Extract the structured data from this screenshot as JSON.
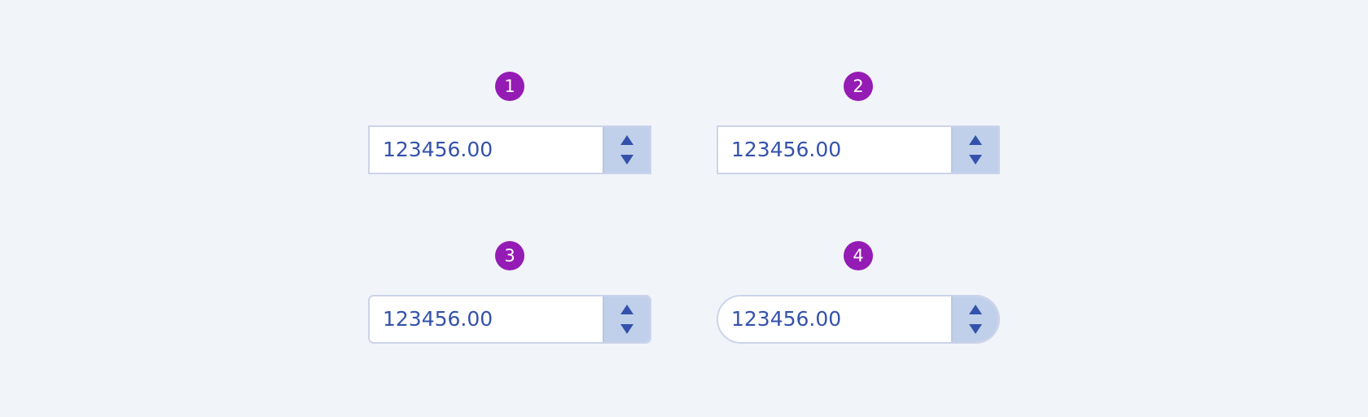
{
  "steppers": [
    {
      "badge": "1",
      "value": "123456.00",
      "corner_style": "square"
    },
    {
      "badge": "2",
      "value": "123456.00",
      "corner_style": "slightly-rounded"
    },
    {
      "badge": "3",
      "value": "123456.00",
      "corner_style": "rounded"
    },
    {
      "badge": "4",
      "value": "123456.00",
      "corner_style": "pill"
    }
  ],
  "icons": {
    "increment": "triangle-up-icon",
    "decrement": "triangle-down-icon"
  },
  "colors": {
    "background": "#f1f4f9",
    "badge": "#951bb5",
    "text": "#3452ab",
    "border": "#ccd4ea",
    "spin_background": "#c1d0ea"
  }
}
